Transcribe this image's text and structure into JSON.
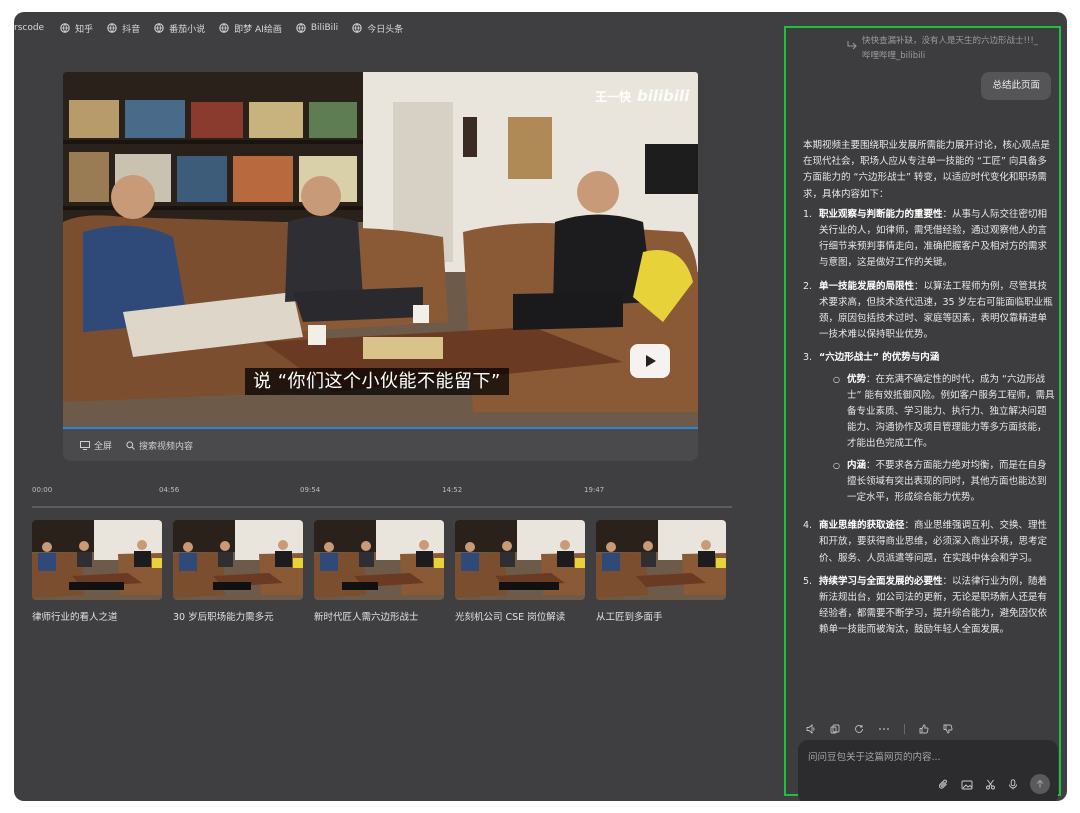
{
  "bookmarks": [
    {
      "label": "rscode",
      "icon": "globe-icon"
    },
    {
      "label": "知乎",
      "icon": "globe-icon"
    },
    {
      "label": "抖音",
      "icon": "globe-icon"
    },
    {
      "label": "番茄小说",
      "icon": "globe-icon"
    },
    {
      "label": "即梦 AI绘画",
      "icon": "globe-icon"
    },
    {
      "label": "BiliBili",
      "icon": "globe-icon"
    },
    {
      "label": "今日头条",
      "icon": "globe-icon"
    }
  ],
  "video": {
    "subtitle": "说 “你们这个小伙能不能留下”",
    "watermark_name": "王一快",
    "watermark_brand": "bilibili"
  },
  "controls": {
    "fullscreen": "全屏",
    "search": "搜索视频内容"
  },
  "timeline": {
    "timestamps": [
      "00:00",
      "04:56",
      "09:54",
      "14:52",
      "19:47"
    ],
    "chapters": [
      "律师行业的看人之道",
      "30 岁后职场能力需多元",
      "新时代匠人需六边形战士",
      "光刻机公司 CSE 岗位解读",
      "从工匠到多面手"
    ]
  },
  "panel": {
    "reference": "快快查漏补缺，没有人是天生的六边形战士!!!_哔哩哔哩_bilibili",
    "user_message": "总结此页面",
    "intro": "本期视频主要围绕职业发展所需能力展开讨论，核心观点是在现代社会，职场人应从专注单一技能的 “工匠” 向具备多方面能力的 “六边形战士” 转变，以适应时代变化和职场需求，具体内容如下：",
    "items": [
      {
        "num": "1.",
        "title": "职业观察与判断能力的重要性",
        "text": "：从事与人际交往密切相关行业的人，如律师，需凭借经验，通过观察他人的言行细节来预判事情走向，准确把握客户及相对方的需求与意图，这是做好工作的关键。"
      },
      {
        "num": "2.",
        "title": "单一技能发展的局限性",
        "text": "：以算法工程师为例，尽管其技术要求高，但技术迭代迅速，35 岁左右可能面临职业瓶颈，原因包括技术过时、家庭等因素，表明仅靠精进单一技术难以保持职业优势。"
      },
      {
        "num": "3.",
        "title": "“六边形战士” 的优势与内涵",
        "text": ""
      },
      {
        "num": "4.",
        "title": "商业思维的获取途径",
        "text": "：商业思维强调互利、交换、理性和开放，要获得商业思维，必须深入商业环境，思考定价、服务、人员派遣等问题，在实践中体会和学习。"
      },
      {
        "num": "5.",
        "title": "持续学习与全面发展的必要性",
        "text": "：以法律行业为例，随着新法规出台，如公司法的更新，无论是职场新人还是有经验者，都需要不断学习，提升综合能力，避免因仅依赖单一技能而被淘汰，鼓励年轻人全面发展。"
      }
    ],
    "subitems": [
      {
        "title": "优势",
        "text": "：在充满不确定性的时代，成为 “六边形战士” 能有效抵御风险。例如客户服务工程师，需具备专业素质、学习能力、执行力、独立解决问题能力、沟通协作及项目管理能力等多方面技能，才能出色完成工作。"
      },
      {
        "title": "内涵",
        "text": "：不要求各方面能力绝对均衡，而是在自身擅长领域有突出表现的同时，其他方面也能达到一定水平，形成综合能力优势。"
      }
    ],
    "input_placeholder": "问问豆包关于这篇网页的内容..."
  },
  "colors": {
    "window_bg": "#3f3f41",
    "panel_border": "#1fbf3f",
    "progress": "#2b88d8"
  }
}
